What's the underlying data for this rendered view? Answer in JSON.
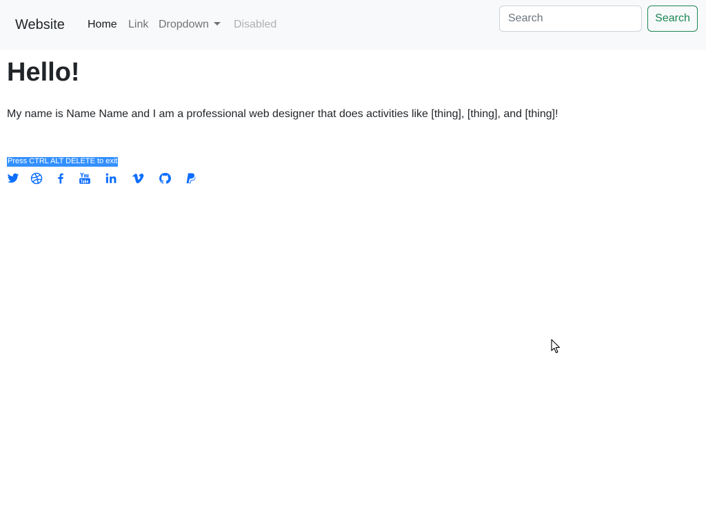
{
  "navbar": {
    "brand": "Website",
    "links": [
      {
        "label": "Home",
        "state": "active"
      },
      {
        "label": "Link",
        "state": "normal"
      },
      {
        "label": "Dropdown",
        "state": "dropdown"
      },
      {
        "label": "Disabled",
        "state": "disabled"
      }
    ],
    "search": {
      "placeholder": "Search",
      "value": "",
      "button_label": "Search"
    }
  },
  "main": {
    "heading": "Hello!",
    "intro": "My name is Name Name and I am a professional web designer that does activities like [thing], [thing], and [thing]!",
    "exit_note": "Press CTRL ALT DELETE to exit",
    "social_icons": [
      "twitter-icon",
      "dribbble-icon",
      "facebook-icon",
      "youtube-icon",
      "linkedin-icon",
      "vimeo-icon",
      "github-icon",
      "paypal-icon"
    ]
  },
  "colors": {
    "navbar_bg": "#f8f9fa",
    "link_blue": "#0d6efd",
    "search_button": "#198754",
    "selection_highlight": "#3390ff"
  }
}
